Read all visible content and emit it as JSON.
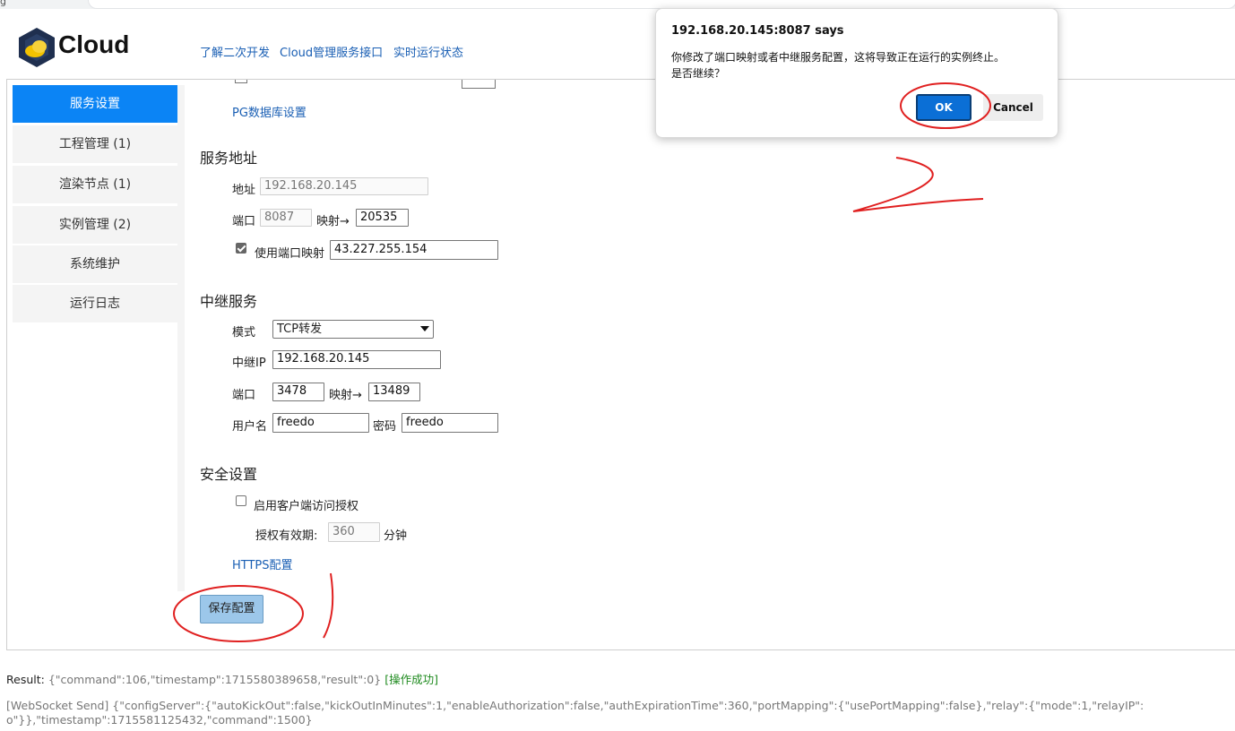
{
  "browser": {
    "tab_fragment": "g"
  },
  "header": {
    "logo_text": "Cloud",
    "links": [
      "了解二次开发",
      "Cloud管理服务接口",
      "实时运行状态"
    ]
  },
  "sidebar": {
    "items": [
      {
        "label": "服务设置",
        "active": true
      },
      {
        "label": "工程管理 (1)"
      },
      {
        "label": "渲染节点 (1)"
      },
      {
        "label": "实例管理 (2)"
      },
      {
        "label": "系统维护"
      },
      {
        "label": "运行日志"
      }
    ]
  },
  "top_partial": {
    "pg_link": "PG数据库设置"
  },
  "service_address": {
    "title": "服务地址",
    "address_label": "地址",
    "address_value": "192.168.20.145",
    "port_label": "端口",
    "port_value": "8087",
    "map_label": "映射→",
    "map_value": "20535",
    "use_mapping_label": "使用端口映射",
    "use_mapping_checked": true,
    "mapping_ip": "43.227.255.154"
  },
  "relay": {
    "title": "中继服务",
    "mode_label": "模式",
    "mode_value": "TCP转发",
    "ip_label": "中继IP",
    "ip_value": "192.168.20.145",
    "port_label": "端口",
    "port_value": "3478",
    "map_label": "映射→",
    "map_value": "13489",
    "user_label": "用户名",
    "user_value": "freedo",
    "pass_label": "密码",
    "pass_value": "freedo"
  },
  "security": {
    "title": "安全设置",
    "auth_label": "启用客户端访问授权",
    "auth_checked": false,
    "expire_label": "授权有效期:",
    "expire_value": "360",
    "expire_unit": "分钟",
    "https_link": "HTTPS配置"
  },
  "save_button": "保存配置",
  "log": {
    "result_key": "Result:",
    "result_json": "{\"command\":106,\"timestamp\":1715580389658,\"result\":0}",
    "result_status": "[操作成功]",
    "ws_line1": "[WebSocket Send] {\"configServer\":{\"autoKickOut\":false,\"kickOutInMinutes\":1,\"enableAuthorization\":false,\"authExpirationTime\":360,\"portMapping\":{\"usePortMapping\":false},\"relay\":{\"mode\":1,\"relayIP\":",
    "ws_line2": "o\"}},\"timestamp\":1715581125432,\"command\":1500}"
  },
  "dialog": {
    "title": "192.168.20.145:8087 says",
    "message_line1": "你修改了端口映射或者中继服务配置，这将导致正在运行的实例终止。",
    "message_line2": "是否继续？",
    "ok_label": "OK",
    "cancel_label": "Cancel"
  },
  "colors": {
    "accent": "#0b84f5",
    "link": "#1a5fb4",
    "annotation": "#e02020",
    "ok_button": "#0b6fd6"
  }
}
